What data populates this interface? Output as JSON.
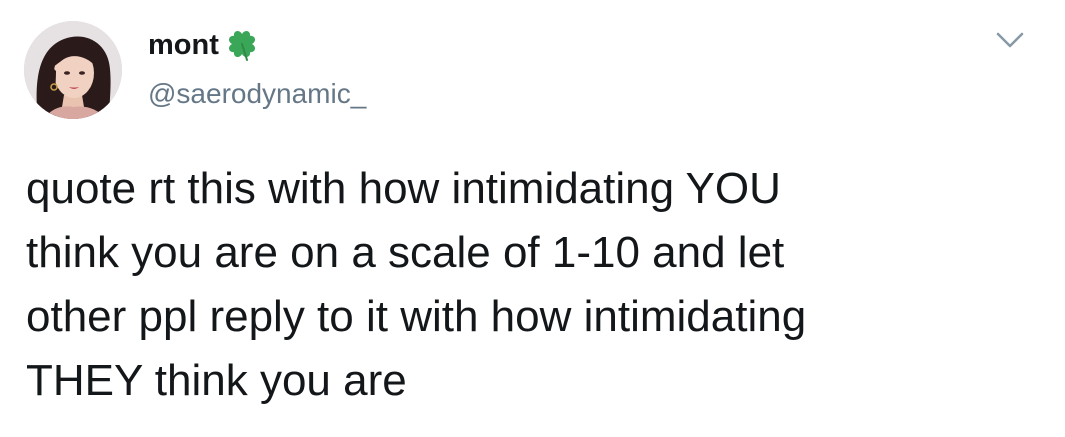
{
  "tweet": {
    "author": {
      "display_name": "mont",
      "handle": "@saerodynamic_",
      "name_emoji": "four-leaf-clover-icon",
      "avatar": "profile-photo"
    },
    "menu_icon": "chevron-down-icon",
    "text_lines": [
      "quote rt this with how intimidating YOU",
      "think you are on a scale of 1-10 and let",
      "other ppl reply to it with how intimidating",
      "THEY think you are"
    ]
  },
  "colors": {
    "text": "#14171a",
    "secondary_text": "#657786",
    "clover": "#3aa657",
    "chevron": "#8899a6",
    "background": "#ffffff"
  }
}
